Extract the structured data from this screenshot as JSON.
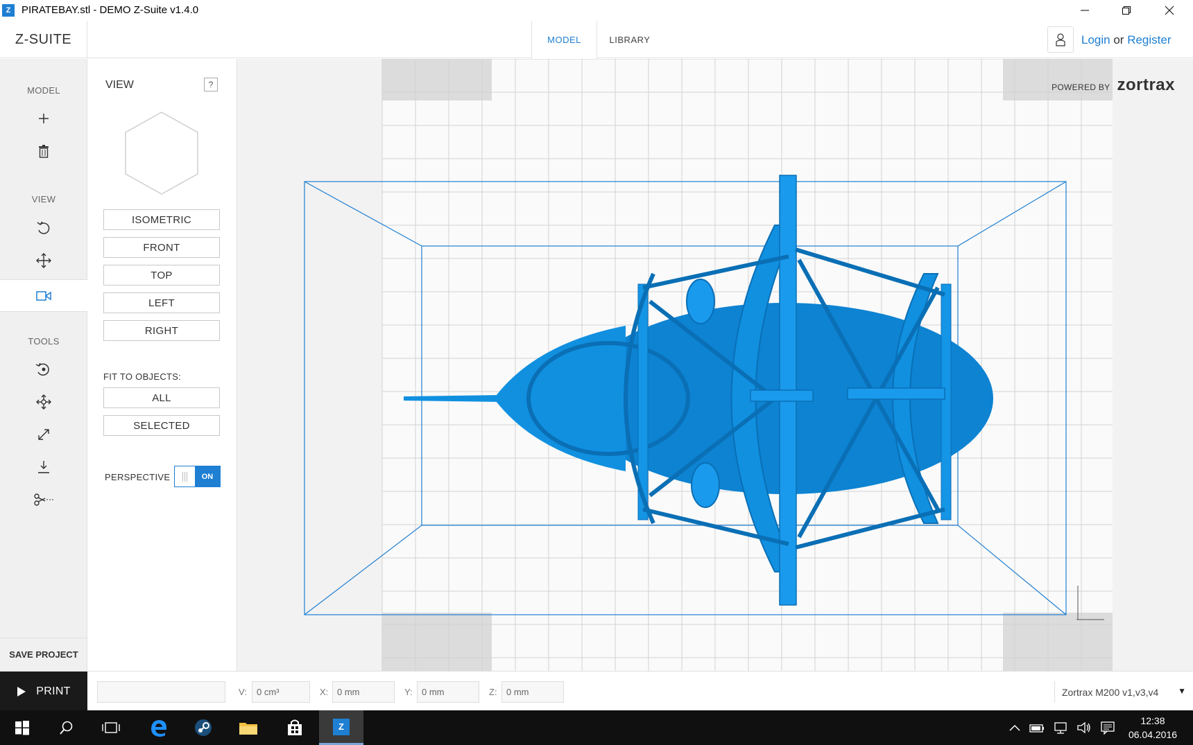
{
  "window": {
    "app_icon": "Z",
    "title": "PIRATEBAY.stl - DEMO Z-Suite v1.4.0",
    "controls": [
      "minimize-icon",
      "restore-icon",
      "close-icon"
    ]
  },
  "header": {
    "logo": "Z-SUITE",
    "tabs": [
      {
        "label": "MODEL",
        "active": true
      },
      {
        "label": "LIBRARY",
        "active": false
      }
    ],
    "login": "Login",
    "or": "or",
    "register": "Register"
  },
  "toolbar": {
    "model_label": "MODEL",
    "view_label": "VIEW",
    "tools_label": "TOOLS",
    "save_project": "SAVE PROJECT"
  },
  "view_panel": {
    "title": "VIEW",
    "help": "?",
    "buttons": [
      "ISOMETRIC",
      "FRONT",
      "TOP",
      "LEFT",
      "RIGHT"
    ],
    "fit_label": "FIT TO OBJECTS:",
    "fit_buttons": [
      "ALL",
      "SELECTED"
    ],
    "perspective_label": "PERSPECTIVE",
    "perspective_state": "ON"
  },
  "viewport": {
    "powered_by": "POWERED BY",
    "brand": "zortrax",
    "model_color": "#0f86d4"
  },
  "bottom": {
    "print": "PRINT",
    "v_label": "V:",
    "v_value": "0 cm³",
    "x_label": "X:",
    "x_value": "0 mm",
    "y_label": "Y:",
    "y_value": "0 mm",
    "z_label": "Z:",
    "z_value": "0 mm",
    "printer": "Zortrax M200 v1,v3,v4"
  },
  "taskbar": {
    "time": "12:38",
    "date": "06.04.2016",
    "active_app": "Z"
  },
  "colors": {
    "accent": "#1e7fd3",
    "model": "#0f86d4"
  }
}
